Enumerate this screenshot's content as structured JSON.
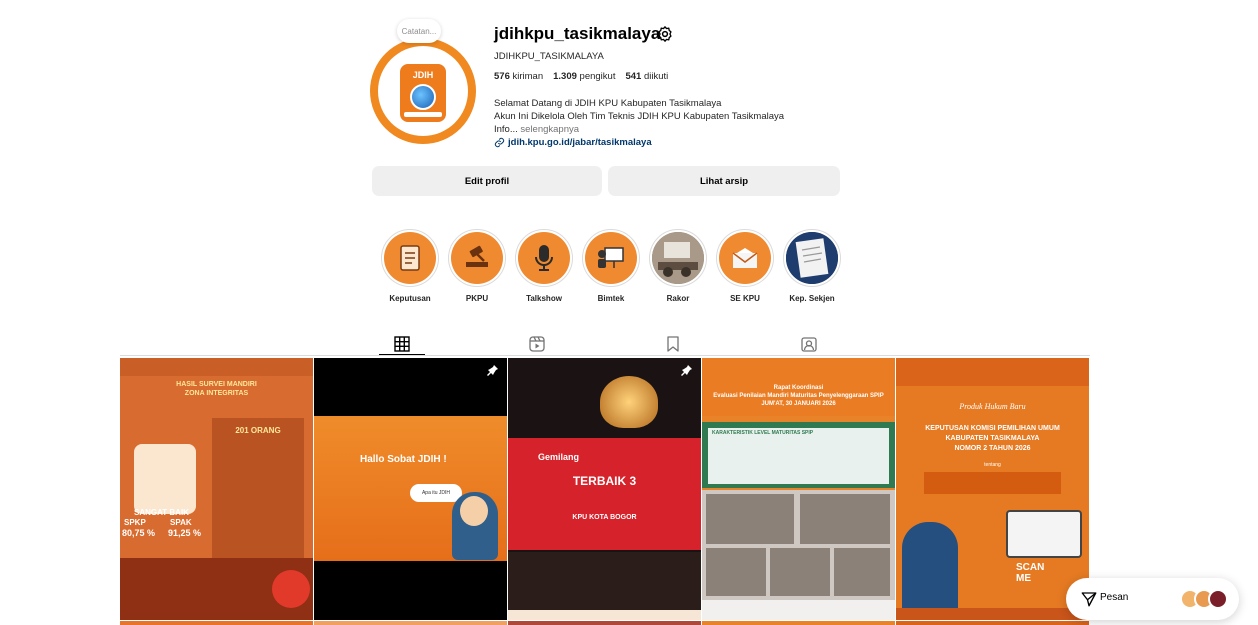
{
  "profile": {
    "note": "Catatan...",
    "username": "jdihkpu_tasikmalaya",
    "full_name": "JDIHKPU_TASIKMALAYA",
    "logo_text": "JDIH",
    "stats": {
      "posts_count": "576",
      "posts_label": "kiriman",
      "followers_count": "1.309",
      "followers_label": "pengikut",
      "following_count": "541",
      "following_label": "diikuti"
    },
    "bio_line1": "Selamat Datang di JDIH KPU Kabupaten Tasikmalaya",
    "bio_line2": "Akun Ini Dikelola Oleh Tim Teknis JDIH KPU Kabupaten Tasikmalaya",
    "bio_line3": "Info...",
    "more_label": "selengkapnya",
    "link": "jdih.kpu.go.id/jabar/tasikmalaya"
  },
  "buttons": {
    "edit_profile": "Edit profil",
    "view_archive": "Lihat arsip"
  },
  "highlights": [
    {
      "label": "Keputusan",
      "icon": "document-icon"
    },
    {
      "label": "PKPU",
      "icon": "gavel-icon"
    },
    {
      "label": "Talkshow",
      "icon": "microphone-icon"
    },
    {
      "label": "Bimtek",
      "icon": "presentation-icon"
    },
    {
      "label": "Rakor",
      "icon": "meeting-photo"
    },
    {
      "label": "SE KPU",
      "icon": "envelope-icon"
    },
    {
      "label": "Kep. Sekjen",
      "icon": "document-photo"
    }
  ],
  "tabs": [
    {
      "name": "posts",
      "icon": "grid-icon",
      "active": true
    },
    {
      "name": "reels",
      "icon": "reels-icon",
      "active": false
    },
    {
      "name": "saved",
      "icon": "bookmark-icon",
      "active": false
    },
    {
      "name": "tagged",
      "icon": "tagged-icon",
      "active": false
    }
  ],
  "posts": {
    "p1": {
      "title_a": "HASIL SURVEI MANDIRI",
      "title_b": "ZONA INTEGRITAS",
      "respondents": "201 ORANG",
      "rating": "SANGAT BAIK",
      "spkp": "SPKP",
      "spak": "SPAK",
      "spkp_value": "80,75 %",
      "spak_value": "91,25 %"
    },
    "p2": {
      "headline": "Hallo Sobat JDIH !",
      "bubble": "Apa itu JDIH"
    },
    "p3": {
      "brand": "Gemilang",
      "headline": "TERBAIK 3",
      "subtitle": "KPU KOTA BOGOR"
    },
    "p4": {
      "title_a": "Rapat Koordinasi",
      "title_b": "Evaluasi Penilaian Mandiri Maturitas Penyelenggaraan SPIP",
      "date": "JUM'AT, 30 JANUARI 2026",
      "section": "KARAKTERISTIK LEVEL MATURITAS SPIP"
    },
    "p5": {
      "produk": "Produk Hukum Baru",
      "title_a": "KEPUTUSAN KOMISI PEMILIHAN UMUM",
      "title_b": "KABUPATEN TASIKMALAYA",
      "title_c": "NOMOR 2 TAHUN 2026",
      "tentang": "tentang",
      "scan_a": "SCAN",
      "scan_b": "ME"
    }
  },
  "dock": {
    "label": "Pesan"
  },
  "colors": {
    "brand_orange": "#f0891f",
    "link_blue": "#00376b",
    "button_gray": "#efefef"
  }
}
